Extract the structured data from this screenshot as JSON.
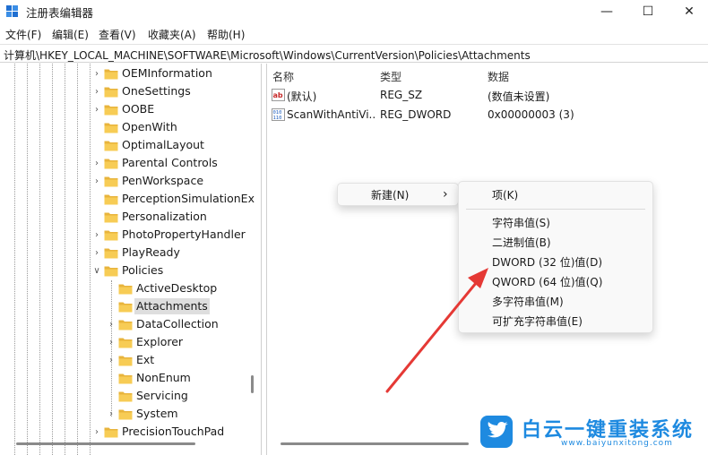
{
  "window": {
    "title": "注册表编辑器",
    "minimize_glyph": "—",
    "maximize_glyph": "☐",
    "close_glyph": "✕"
  },
  "menu": [
    "文件(F)",
    "编辑(E)",
    "查看(V)",
    "收藏夹(A)",
    "帮助(H)"
  ],
  "address": "计算机\\HKEY_LOCAL_MACHINE\\SOFTWARE\\Microsoft\\Windows\\CurrentVersion\\Policies\\Attachments",
  "tree": {
    "items": [
      {
        "label": "OEMInformation",
        "level": 0,
        "expander": "›",
        "selected": false
      },
      {
        "label": "OneSettings",
        "level": 0,
        "expander": "›",
        "selected": false
      },
      {
        "label": "OOBE",
        "level": 0,
        "expander": "›",
        "selected": false
      },
      {
        "label": "OpenWith",
        "level": 0,
        "expander": "",
        "selected": false
      },
      {
        "label": "OptimalLayout",
        "level": 0,
        "expander": "",
        "selected": false
      },
      {
        "label": "Parental Controls",
        "level": 0,
        "expander": "›",
        "selected": false
      },
      {
        "label": "PenWorkspace",
        "level": 0,
        "expander": "›",
        "selected": false
      },
      {
        "label": "PerceptionSimulationEx",
        "level": 0,
        "expander": "",
        "selected": false
      },
      {
        "label": "Personalization",
        "level": 0,
        "expander": "",
        "selected": false
      },
      {
        "label": "PhotoPropertyHandler",
        "level": 0,
        "expander": "›",
        "selected": false
      },
      {
        "label": "PlayReady",
        "level": 0,
        "expander": "›",
        "selected": false
      },
      {
        "label": "Policies",
        "level": 0,
        "expander": "∨",
        "selected": false
      },
      {
        "label": "ActiveDesktop",
        "level": 1,
        "expander": "",
        "selected": false
      },
      {
        "label": "Attachments",
        "level": 1,
        "expander": "",
        "selected": true
      },
      {
        "label": "DataCollection",
        "level": 1,
        "expander": "›",
        "selected": false
      },
      {
        "label": "Explorer",
        "level": 1,
        "expander": "›",
        "selected": false
      },
      {
        "label": "Ext",
        "level": 1,
        "expander": "›",
        "selected": false
      },
      {
        "label": "NonEnum",
        "level": 1,
        "expander": "",
        "selected": false
      },
      {
        "label": "Servicing",
        "level": 1,
        "expander": "",
        "selected": false
      },
      {
        "label": "System",
        "level": 1,
        "expander": "›",
        "selected": false
      },
      {
        "label": "PrecisionTouchPad",
        "level": 0,
        "expander": "›",
        "selected": false
      }
    ]
  },
  "list": {
    "columns": {
      "name": "名称",
      "type": "类型",
      "data": "数据"
    },
    "rows": [
      {
        "icon": "string-value-icon",
        "name": "(默认)",
        "type": "REG_SZ",
        "data": "(数值未设置)"
      },
      {
        "icon": "binary-value-icon",
        "name": "ScanWithAntiVi...",
        "type": "REG_DWORD",
        "data": "0x00000003 (3)"
      }
    ]
  },
  "context_menu": {
    "new_label": "新建(N)",
    "submenu_arrow": "›",
    "items_top": [
      "项(K)"
    ],
    "items": [
      "字符串值(S)",
      "二进制值(B)",
      "DWORD (32 位)值(D)",
      "QWORD (64 位)值(Q)",
      "多字符串值(M)",
      "可扩充字符串值(E)"
    ]
  },
  "annotation": {
    "arrow_color": "#e53935"
  },
  "watermark": {
    "main": "白云一键重装系统",
    "sub": "www.baiyunxitong.com",
    "color": "#1e8ae0"
  }
}
